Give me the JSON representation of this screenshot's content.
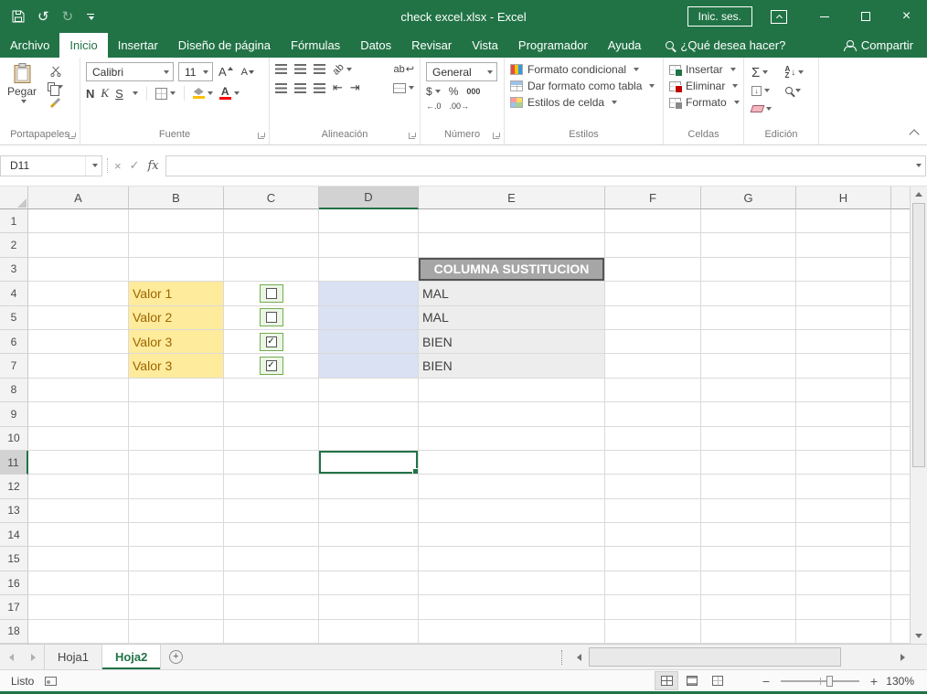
{
  "window": {
    "title": "check excel.xlsx - Excel",
    "sign_in": "Inic. ses."
  },
  "menu": {
    "file": "Archivo",
    "tabs": [
      "Inicio",
      "Insertar",
      "Diseño de página",
      "Fórmulas",
      "Datos",
      "Revisar",
      "Vista",
      "Programador",
      "Ayuda"
    ],
    "active_tab": "Inicio",
    "search": "¿Qué desea hacer?",
    "share": "Compartir"
  },
  "ribbon": {
    "paste": "Pegar",
    "groups": {
      "clipboard": "Portapapeles",
      "font": "Fuente",
      "alignment": "Alineación",
      "number": "Número",
      "styles": "Estilos",
      "cells": "Celdas",
      "editing": "Edición"
    },
    "font_name": "Calibri",
    "font_size": "11",
    "bold": "N",
    "italic": "K",
    "underline": "S",
    "number_format": "General",
    "currency": "$",
    "percent": "%",
    "thousands": "000",
    "conditional_formatting": "Formato condicional",
    "format_as_table": "Dar formato como tabla",
    "cell_styles": "Estilos de celda",
    "insert": "Insertar",
    "delete": "Eliminar",
    "format": "Formato",
    "autosum": "Σ"
  },
  "formula_bar": {
    "name_box": "D11",
    "cancel": "×",
    "enter": "✓",
    "fx": "fx",
    "formula": ""
  },
  "grid": {
    "columns": [
      "A",
      "B",
      "C",
      "D",
      "E",
      "F",
      "G",
      "H"
    ],
    "row_count": 18,
    "active_cell": "D11",
    "active_column": "D",
    "active_row": 11,
    "check_glyph": "✓",
    "cells": [
      {
        "ref": "E3",
        "text": "COLUMNA SUSTITUCION",
        "bg": "#A6A6A6",
        "color": "#FFFFFF",
        "bold": true,
        "center": true,
        "outlined": true
      },
      {
        "ref": "B4",
        "text": "Valor 1",
        "bg": "#FFEB9C",
        "color": "#9C6500"
      },
      {
        "ref": "B5",
        "text": "Valor 2",
        "bg": "#FFEB9C",
        "color": "#9C6500"
      },
      {
        "ref": "B6",
        "text": "Valor 3",
        "bg": "#FFEB9C",
        "color": "#9C6500"
      },
      {
        "ref": "B7",
        "text": "Valor 3",
        "bg": "#FFEB9C",
        "color": "#9C6500"
      },
      {
        "ref": "C4",
        "checkbox": true,
        "checked": false
      },
      {
        "ref": "C5",
        "checkbox": true,
        "checked": false
      },
      {
        "ref": "C6",
        "checkbox": true,
        "checked": true
      },
      {
        "ref": "C7",
        "checkbox": true,
        "checked": true
      },
      {
        "ref": "D4",
        "bg": "#D9E1F2"
      },
      {
        "ref": "D5",
        "bg": "#D9E1F2"
      },
      {
        "ref": "D6",
        "bg": "#D9E1F2"
      },
      {
        "ref": "D7",
        "bg": "#D9E1F2"
      },
      {
        "ref": "E4",
        "text": "MAL",
        "bg": "#EDEDED",
        "color": "#3F3F3F"
      },
      {
        "ref": "E5",
        "text": "MAL",
        "bg": "#EDEDED",
        "color": "#3F3F3F"
      },
      {
        "ref": "E6",
        "text": "BIEN",
        "bg": "#EDEDED",
        "color": "#3F3F3F"
      },
      {
        "ref": "E7",
        "text": "BIEN",
        "bg": "#EDEDED",
        "color": "#3F3F3F"
      }
    ]
  },
  "sheet_bar": {
    "tabs": [
      {
        "label": "Hoja1",
        "active": false
      },
      {
        "label": "Hoja2",
        "active": true
      }
    ]
  },
  "status_bar": {
    "status": "Listo",
    "zoom": "130%"
  },
  "icons": {
    "undo": "↺",
    "redo": "↻",
    "close": "×",
    "plus": "+",
    "minus": "−",
    "letterA": "A",
    "letterZ": "Z",
    "arrow_down": "↓",
    "ab": "ab",
    "return": "↩",
    "indent_left": "⇤",
    "indent_right": "⇥",
    "inc_decimal": "←.0",
    "dec_decimal": ".00→"
  },
  "colors": {
    "accent_green": "#217346",
    "valor_bg": "#FFEB9C",
    "valor_text": "#9C6500",
    "blue_fill": "#D9E1F2",
    "result_bg": "#EDEDED",
    "sust_bg": "#A6A6A6",
    "checkbox_frame_bg": "#EDF6E6",
    "checkbox_frame_border": "#72AC4F",
    "fill_color_swatch": "#FFC000",
    "font_color_swatch": "#FF0000"
  }
}
